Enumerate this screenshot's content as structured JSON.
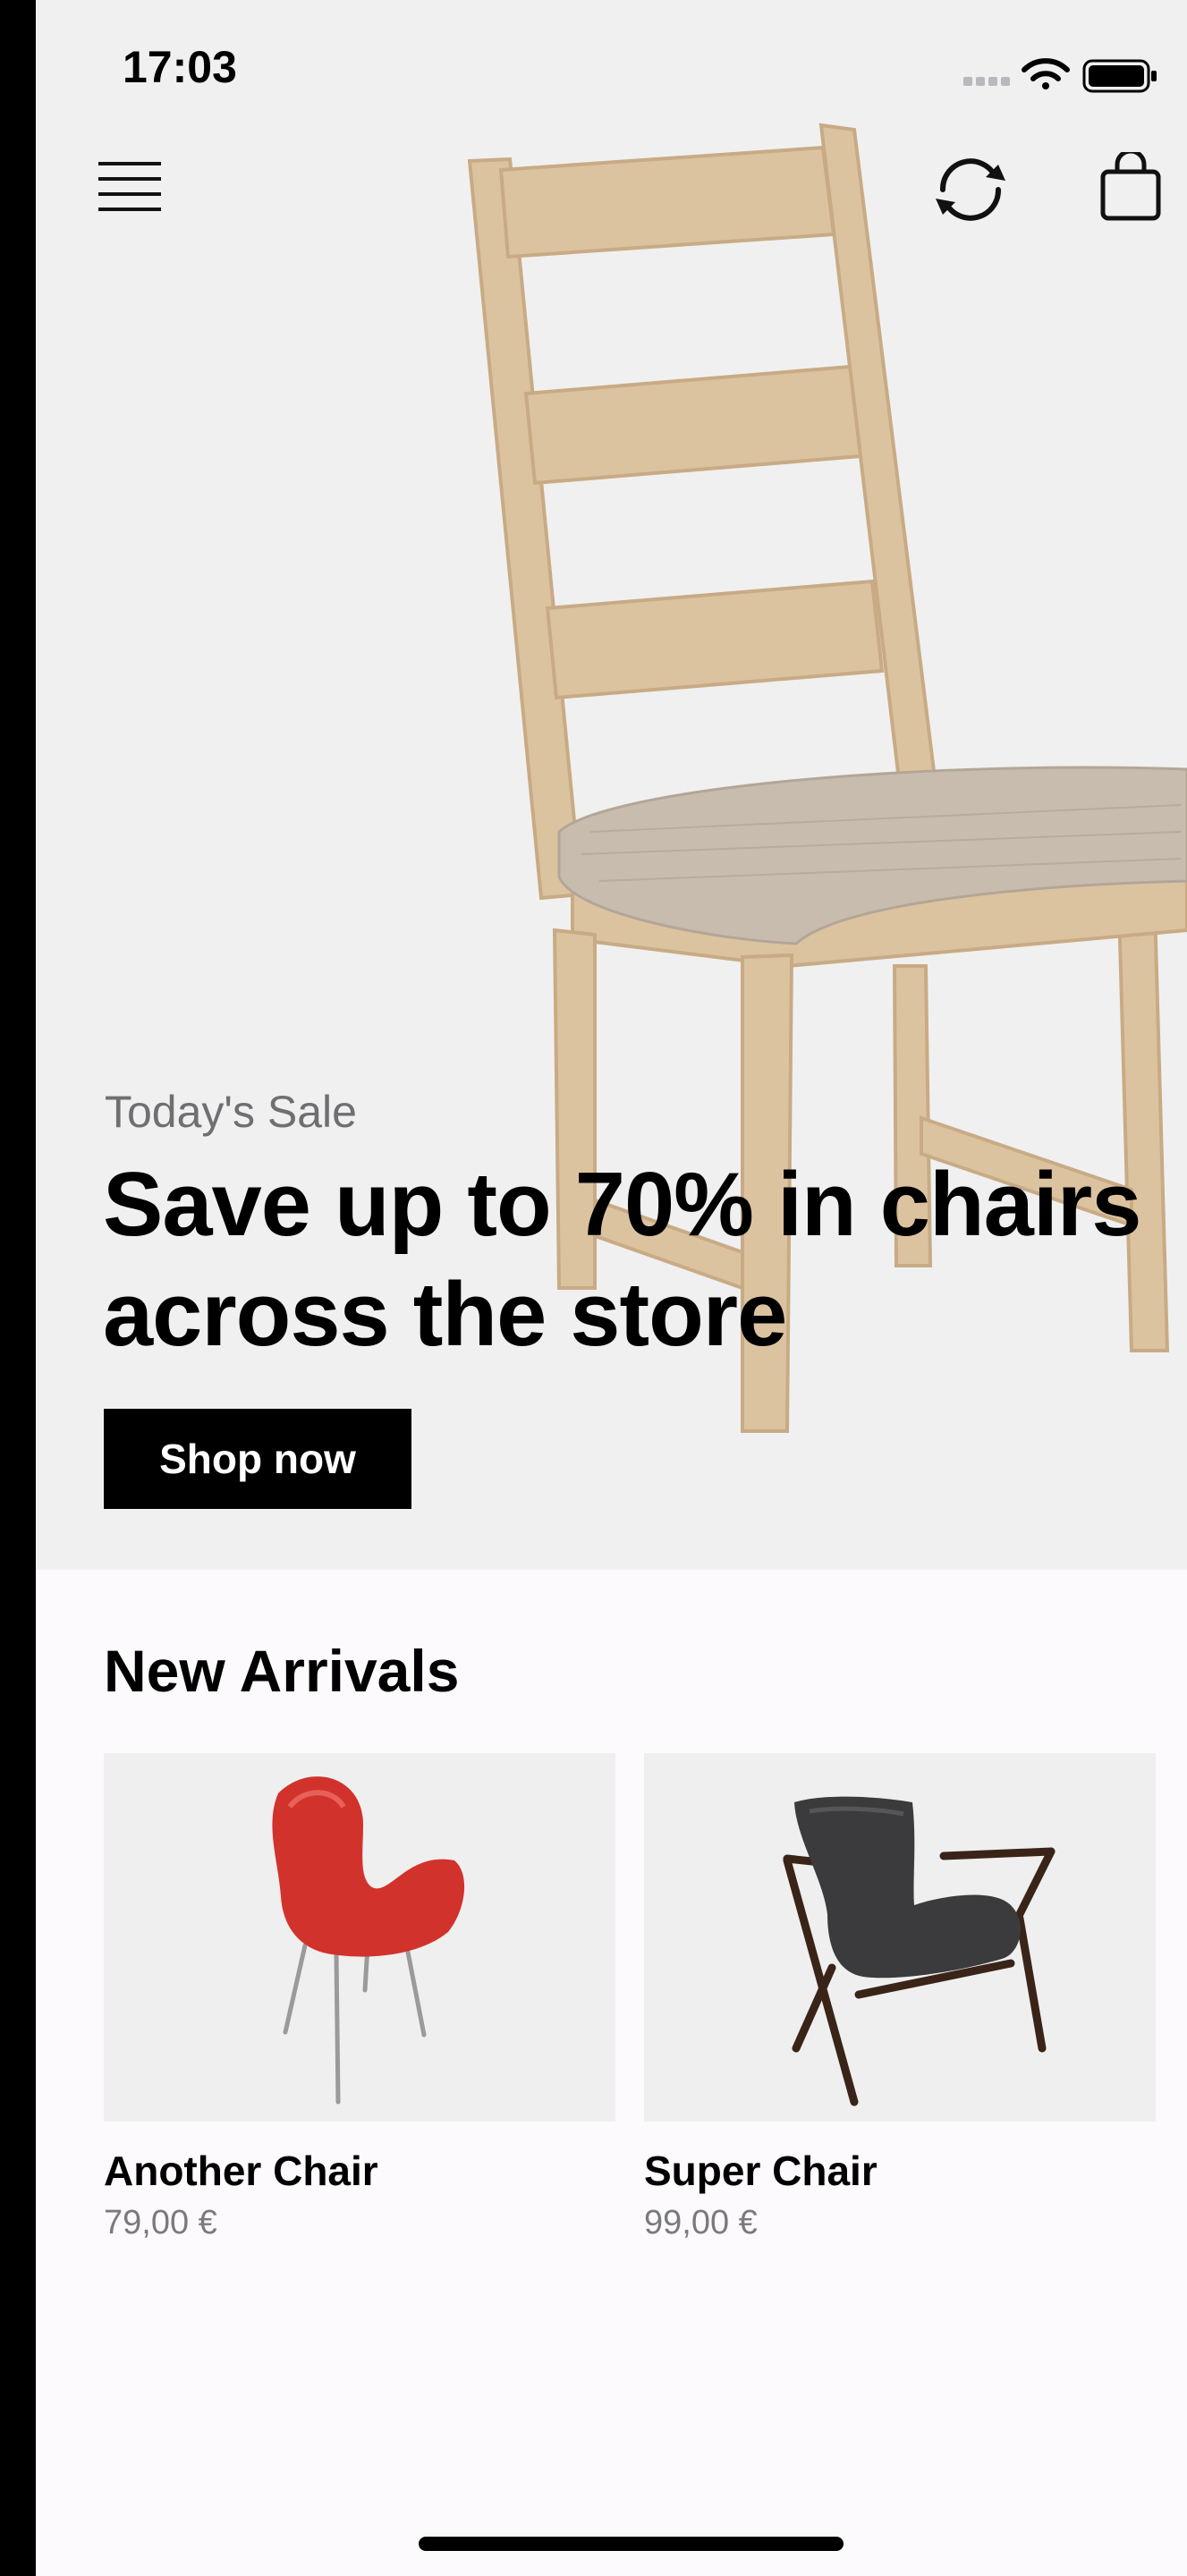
{
  "status_bar": {
    "time": "17:03",
    "icons": [
      "cellular-signal-icon",
      "wifi-icon",
      "battery-icon"
    ]
  },
  "nav": {
    "menu_icon": "hamburger-menu-icon",
    "sync_icon": "refresh-icon",
    "bag_icon": "shopping-bag-icon"
  },
  "hero": {
    "label": "Today's Sale",
    "headline": "Save up to 70% in chairs across the store",
    "cta": "Shop now",
    "image": "wooden-ladder-back-chair"
  },
  "new_arrivals": {
    "title": "New Arrivals",
    "products": [
      {
        "name": "Another Chair",
        "price": "79,00 €",
        "image": "red-shell-chair"
      },
      {
        "name": "Super Chair",
        "price": "99,00 €",
        "image": "dark-armchair"
      }
    ]
  },
  "colors": {
    "hero_bg": "#f0f0f0",
    "page_bg": "#fdfafd",
    "button_bg": "#000000",
    "chair_wood": "#e3c9a6",
    "accent_red": "#d2322c"
  }
}
